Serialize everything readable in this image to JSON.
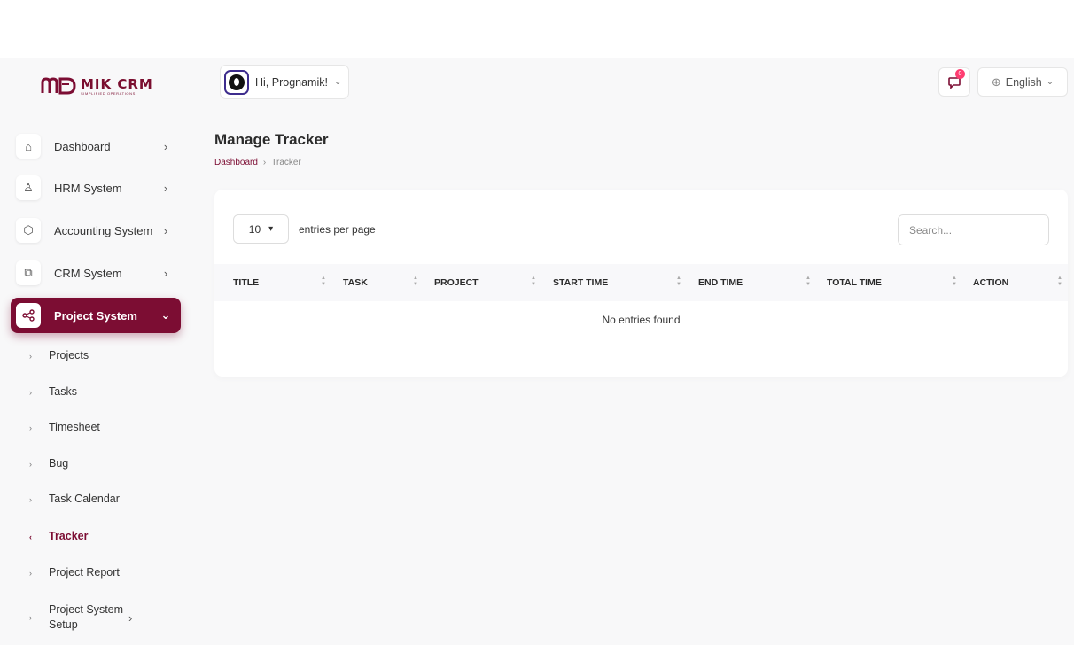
{
  "brand": {
    "name": "MIK CRM",
    "tagline": "SIMPLIFIED OPERATIONS",
    "color": "#7c0d33"
  },
  "sidebar": {
    "items": [
      {
        "label": "Dashboard",
        "icon": "home-icon"
      },
      {
        "label": "HRM System",
        "icon": "user-icon"
      },
      {
        "label": "Accounting System",
        "icon": "box-icon"
      },
      {
        "label": "CRM System",
        "icon": "layers-icon"
      },
      {
        "label": "Project System",
        "icon": "share-icon",
        "active": true
      }
    ],
    "subitems": [
      {
        "label": "Projects"
      },
      {
        "label": "Tasks"
      },
      {
        "label": "Timesheet"
      },
      {
        "label": "Bug"
      },
      {
        "label": "Task Calendar"
      },
      {
        "label": "Tracker",
        "active": true
      },
      {
        "label": "Project Report"
      },
      {
        "label": "Project System Setup"
      }
    ]
  },
  "header": {
    "greeting": "Hi, Prognamik!",
    "notification_count": "0",
    "language": "English"
  },
  "page": {
    "title": "Manage Tracker",
    "breadcrumb": {
      "home": "Dashboard",
      "current": "Tracker"
    }
  },
  "table": {
    "per_page_value": "10",
    "per_page_label": "entries per page",
    "search_placeholder": "Search...",
    "columns": [
      "TITLE",
      "TASK",
      "PROJECT",
      "START TIME",
      "END TIME",
      "TOTAL TIME",
      "ACTION"
    ],
    "empty_message": "No entries found"
  }
}
